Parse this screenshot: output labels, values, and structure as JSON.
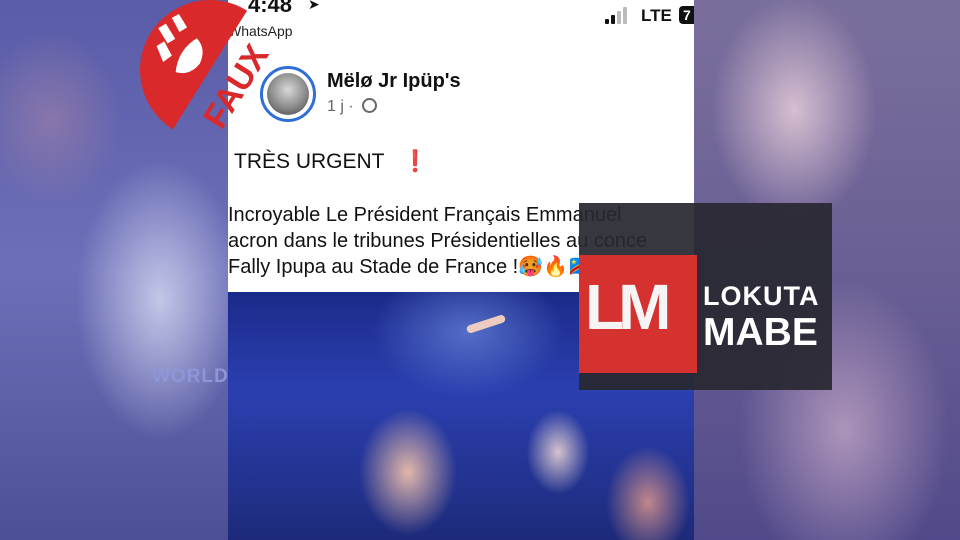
{
  "background": {
    "left_overlay_text": "WORLD"
  },
  "stamp": {
    "label": "FAUX",
    "color": "#d9292b"
  },
  "phone": {
    "status": {
      "time": "4:48",
      "network": "LTE",
      "battery": "7"
    },
    "back_app": "WhatsApp",
    "post": {
      "author": "Mëlø Jr Ipüp's",
      "meta": "1 j ·",
      "title": "TRÈS URGENT",
      "title_mark": "❗",
      "body_lines": [
        "Incroyable Le Président Français Emmanuel",
        "acron dans le tribunes Présidentielles au conce",
        "Fally Ipupa au Stade de France !🥵🔥🇨🇩🦅"
      ]
    }
  },
  "logo": {
    "mark": "LM",
    "line1": "LOKUTA",
    "line2": "MABE",
    "accent_color": "#d4312f"
  }
}
